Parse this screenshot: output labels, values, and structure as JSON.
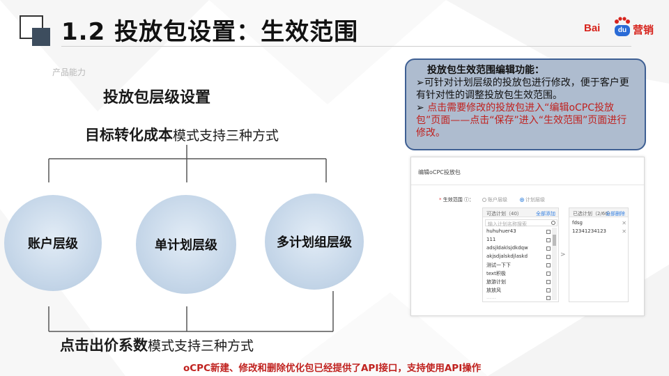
{
  "header": {
    "title": "1.2 投放包设置：生效范围",
    "logo_bai": "Bai",
    "logo_du": "du",
    "logo_suffix": "营销"
  },
  "left": {
    "faint_label": "产品能力",
    "subtitle": "投放包层级设置",
    "top_mode_bold": "目标转化成本",
    "top_mode_rest": "模式支持三种方式",
    "levels": [
      "账户层级",
      "单计划层级",
      "多计划组层级"
    ],
    "bottom_mode_bold": "点击出价系数",
    "bottom_mode_rest": "模式支持三种方式"
  },
  "callout": {
    "title": "投放包生效范围编辑功能：",
    "bullet1": "可针对计划层级的投放包进行修改，便于客户更有针对性的调整投放包生效范围。",
    "bullet2": "点击需要修改的投放包进入“编辑oCPC投放包”页面——点击“保存”进入“生效范围”页面进行修改。",
    "bullet_marker": "➢"
  },
  "screenshot": {
    "title": "编辑oCPC投放包",
    "scope_label": "生效范围",
    "option_account": "账户层级",
    "option_plan": "计划层级",
    "left_panel_header": "可选计划（40）",
    "left_panel_action": "全部添加",
    "search_placeholder": "输入计划名称搜索",
    "left_items": [
      "huhuhuer43",
      "111",
      "adsjldaklsjdkdqw",
      "akjsdjalskdjlaskd",
      "测试一下下",
      "text积极",
      "旅游计划",
      "放放风",
      "……"
    ],
    "right_panel_header": "已选计划（2/60）",
    "right_panel_action": "全部删除",
    "right_items": [
      "fdsg",
      "12341234123"
    ]
  },
  "footer": {
    "note": "oCPC新建、修改和删除优化包已经提供了API接口，支持使用API操作"
  },
  "colors": {
    "accent_red": "#c0221f",
    "callout_bg": "#aebccf",
    "callout_border": "#3e5f93",
    "circle_fill": "#c6d7e9",
    "header_square": "#3d4d5e"
  }
}
